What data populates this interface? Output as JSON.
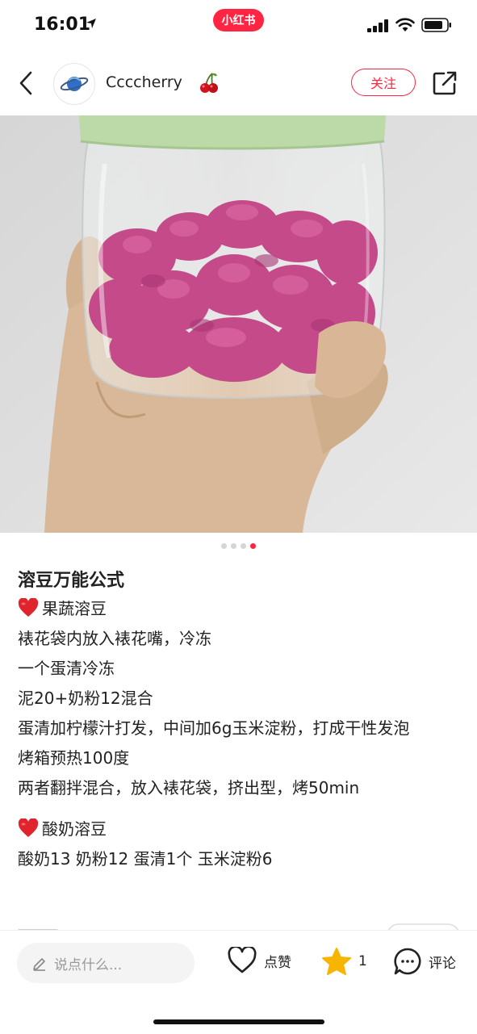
{
  "status_bar": {
    "time": "16:01",
    "app_badge": "小红书"
  },
  "header": {
    "username": "Ccccherry",
    "follow_label": "关注",
    "back_icon": "chevron-left-icon",
    "share_icon": "share-icon"
  },
  "photo": {
    "description_icon": "photo",
    "pages": 4,
    "current_page": 4
  },
  "note": {
    "title": "溶豆万能公式",
    "section1": {
      "heading": "果蔬溶豆",
      "lines": [
        "裱花袋内放入裱花嘴，冷冻",
        "一个蛋清冷冻",
        "泥20+奶粉12混合",
        "蛋清加柠檬汁打发，中间加6g玉米淀粉，打成干性发泡",
        "烤箱预热100度",
        "两者翻拌混合，放入裱花袋，挤出型，烤50min"
      ]
    },
    "section2": {
      "heading": "酸奶溶豆",
      "lines": [
        "酸奶13 奶粉12 蛋清1个 玉米淀粉6"
      ]
    }
  },
  "bottom_bar": {
    "comment_placeholder": "说点什么...",
    "like_label": "点赞",
    "collect_count": "1",
    "comment_label": "评论"
  },
  "colors": {
    "accent": "#ff2442",
    "star": "#f7b500",
    "heart_emoji": "#e0242e"
  }
}
